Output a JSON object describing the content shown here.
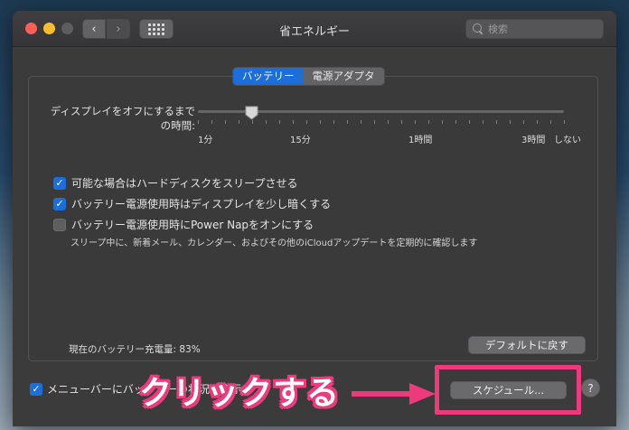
{
  "window": {
    "title": "省エネルギー"
  },
  "toolbar": {
    "back_glyph": "‹",
    "forward_glyph": "›",
    "search_placeholder": "検索"
  },
  "tabs": [
    {
      "label": "バッテリー",
      "active": true
    },
    {
      "label": "電源アダプタ",
      "active": false
    }
  ],
  "display_sleep": {
    "label_line1": "ディスプレイをオフにするまで",
    "label_line2": "の時間:",
    "tick_labels": [
      "1分",
      "15分",
      "1時間",
      "3時間",
      "しない"
    ],
    "selected_value": "15分"
  },
  "options": [
    {
      "label": "可能な場合はハードディスクをスリープさせる",
      "checked": true
    },
    {
      "label": "バッテリー電源使用時はディスプレイを少し暗くする",
      "checked": true
    },
    {
      "label": "バッテリー電源使用時にPower Napをオンにする",
      "checked": false
    }
  ],
  "power_nap_note": "スリープ中に、新着メール、カレンダー、およびその他のiCloudアップデートを定期的に確認します",
  "battery_status": "現在のバッテリー充電量: 83%",
  "buttons": {
    "defaults": "デフォルトに戻す",
    "schedule": "スケジュール...",
    "help": "?"
  },
  "menubar_option": {
    "label": "メニューバーにバッテリーの状況を表示",
    "checked": true
  },
  "annotation": {
    "text": "クリックする",
    "color": "#ec3a7d"
  },
  "colors": {
    "accent": "#1c6fdb",
    "highlight": "#ec3a7d"
  }
}
